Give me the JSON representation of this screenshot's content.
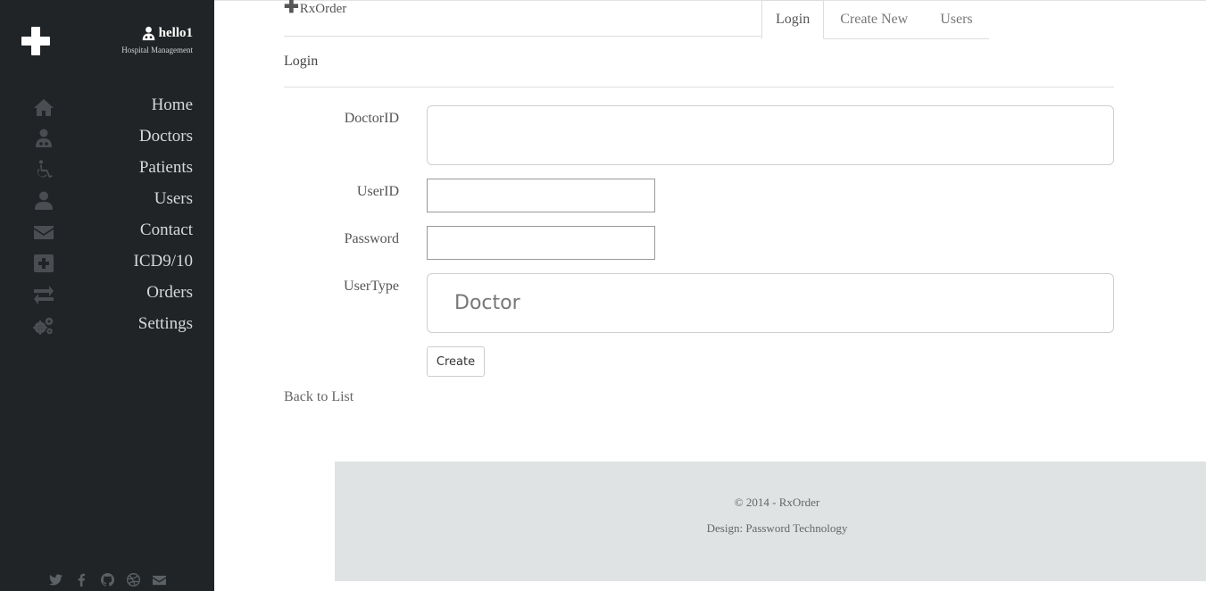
{
  "sidebar": {
    "brand_name": "hello1",
    "brand_subtitle": "Hospital Management",
    "items": [
      {
        "label": "Home",
        "icon": "home-icon"
      },
      {
        "label": "Doctors",
        "icon": "doctor-icon"
      },
      {
        "label": "Patients",
        "icon": "wheelchair-icon"
      },
      {
        "label": "Users",
        "icon": "user-icon"
      },
      {
        "label": "Contact",
        "icon": "envelope-icon"
      },
      {
        "label": "ICD9/10",
        "icon": "plus-square-icon"
      },
      {
        "label": "Orders",
        "icon": "exchange-icon"
      },
      {
        "label": "Settings",
        "icon": "cogs-icon"
      }
    ],
    "social": [
      "twitter-icon",
      "facebook-icon",
      "github-icon",
      "dribbble-icon",
      "mail-icon"
    ]
  },
  "header": {
    "app_name": "RxOrder",
    "tabs": [
      {
        "label": "Login",
        "active": true
      },
      {
        "label": "Create New",
        "active": false
      },
      {
        "label": "Users",
        "active": false
      }
    ]
  },
  "form": {
    "title": "Login",
    "fields": {
      "doctor_id": {
        "label": "DoctorID",
        "value": ""
      },
      "user_id": {
        "label": "UserID",
        "value": ""
      },
      "password": {
        "label": "Password",
        "value": ""
      },
      "user_type": {
        "label": "UserType",
        "value": "Doctor"
      }
    },
    "submit_label": "Create",
    "back_link": "Back to List"
  },
  "footer": {
    "copyright": "© 2014 - RxOrder",
    "design": "Design: Password Technology"
  },
  "colors": {
    "sidebar_bg": "#212426",
    "footer_bg": "#dfe3e3"
  }
}
